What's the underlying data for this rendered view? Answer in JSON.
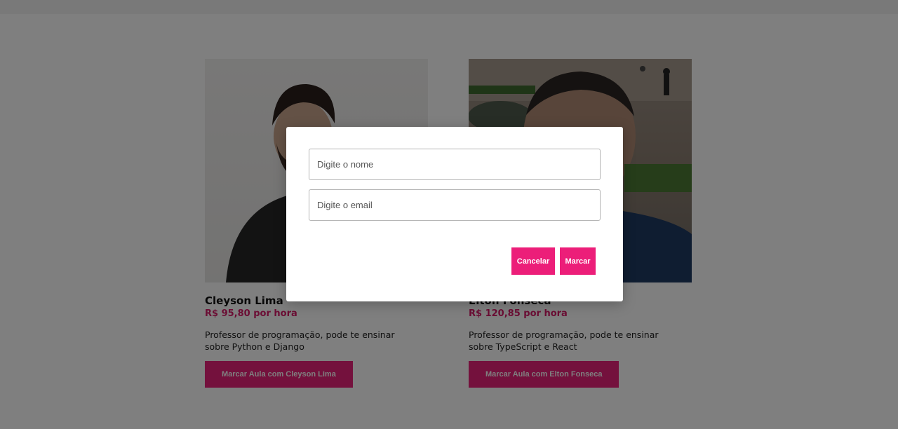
{
  "teachers": [
    {
      "name": "Cleyson Lima",
      "price": "R$ 95,80 por hora",
      "description": "Professor de programação, pode te ensinar sobre Python e Django",
      "button_label": "Marcar Aula com Cleyson Lima"
    },
    {
      "name": "Elton Fonseca",
      "price": "R$ 120,85 por hora",
      "description": "Professor de programação, pode te ensinar sobre TypeScript e React",
      "button_label": "Marcar Aula com Elton Fonseca"
    }
  ],
  "modal": {
    "name_placeholder": "Digite o nome",
    "email_placeholder": "Digite o email",
    "cancel_label": "Cancelar",
    "confirm_label": "Marcar"
  },
  "colors": {
    "accent": "#ec1e79",
    "price": "#d71b68",
    "overlay": "rgba(0,0,0,0.5)"
  }
}
